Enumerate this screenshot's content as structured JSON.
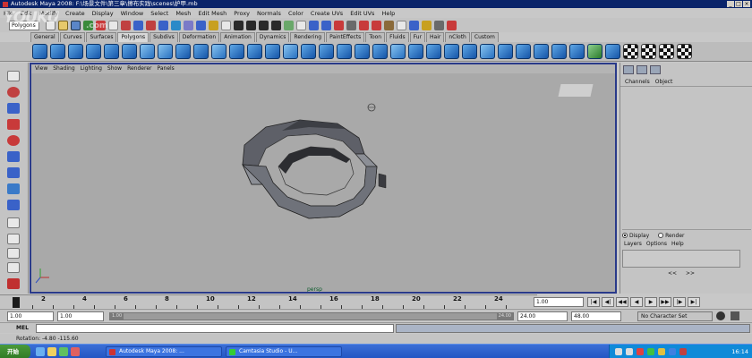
{
  "window": {
    "title": "Autodesk Maya 2008: F:\\场景文件\\第三章\\擦布实践\\scenes\\护甲.mb"
  },
  "menubar": {
    "items": [
      "File",
      "Edit",
      "Modify",
      "Create",
      "Display",
      "Window",
      "Select",
      "Mesh",
      "Edit Mesh",
      "Proxy",
      "Normals",
      "Color",
      "Create UVs",
      "Edit UVs",
      "Help"
    ]
  },
  "statusline": {
    "mode": "Polygons"
  },
  "shelf": {
    "tabs": [
      "General",
      "Curves",
      "Surfaces",
      "Polygons",
      "Subdivs",
      "Deformation",
      "Animation",
      "Dynamics",
      "Rendering",
      "PaintEffects",
      "Toon",
      "Fluids",
      "Fur",
      "Hair",
      "nCloth",
      "Custom"
    ],
    "active_tab": "Polygons"
  },
  "viewport": {
    "menu": [
      "View",
      "Shading",
      "Lighting",
      "Show",
      "Renderer",
      "Panels"
    ],
    "camera": "persp"
  },
  "channelbox": {
    "header": [
      "Channels",
      "Object"
    ],
    "layer_radio_display": "Display",
    "layer_radio_render": "Render",
    "layer_menu": [
      "Layers",
      "Options",
      "Help"
    ]
  },
  "timeslider": {
    "ticks": [
      "2",
      "4",
      "6",
      "8",
      "10",
      "12",
      "14",
      "16",
      "18",
      "20",
      "22",
      "24"
    ],
    "current_frame": "1.00"
  },
  "rangeslider": {
    "start": "1.00",
    "playback_start": "1.00",
    "handle_start": "1.00",
    "handle_end": "24.00",
    "playback_end": "24.00",
    "end": "48.00",
    "character_set": "No Character Set"
  },
  "cmdline": {
    "label": "MEL"
  },
  "helpline": {
    "text": "Rotation: -4.80     -115.60"
  },
  "taskbar": {
    "start": "开始",
    "tasks": [
      "Autodesk Maya 2008: ...",
      "Camtasia Studio - U..."
    ],
    "clock": "16:14"
  },
  "watermark": {
    "text": "YOUKU",
    "sub": ".com"
  }
}
